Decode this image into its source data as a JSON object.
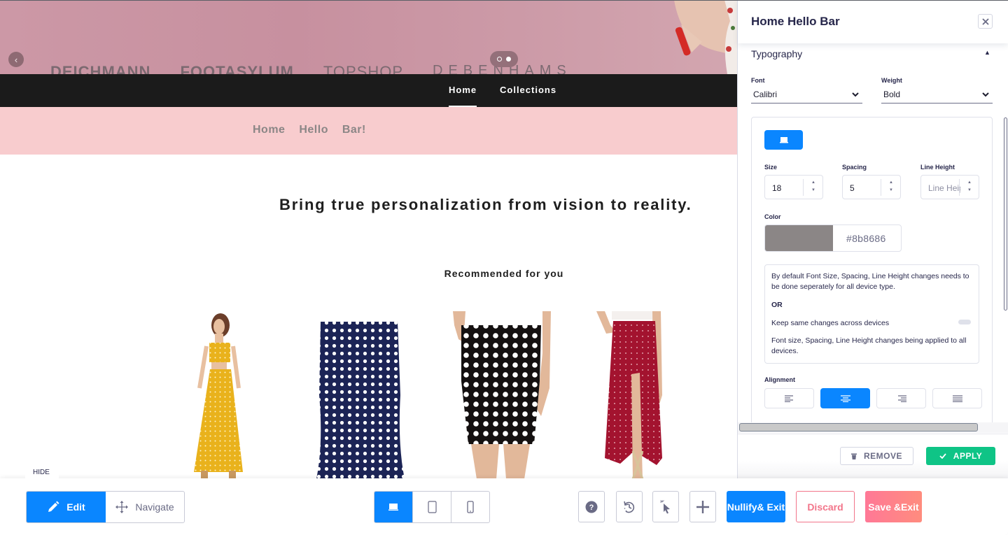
{
  "preview": {
    "hero": {
      "brand_logos": [
        "DEICHMANN",
        "FOOTASYLUM",
        "TOPSHOP",
        "DEBENHAMS"
      ],
      "slide_count": 2,
      "active_slide": 2
    },
    "nav": {
      "items": [
        {
          "label": "Home",
          "active": true
        },
        {
          "label": "Collections",
          "active": false
        }
      ]
    },
    "hello_bar": {
      "text": "Home  Hello  Bar!",
      "background": "#f8ccce",
      "text_color": "#8b8686"
    },
    "headline": "Bring true personalization from vision to reality.",
    "recommendations": {
      "title": "Recommended for you",
      "products": [
        {
          "name": "yellow-polka-dot-maxi-set",
          "color": "#e9b21c"
        },
        {
          "name": "navy-polka-dot-mermaid-skirt",
          "color": "#1c2456"
        },
        {
          "name": "black-polka-dot-pencil-skirt",
          "color": "#141010"
        },
        {
          "name": "red-polka-dot-wrap-maxi-skirt",
          "color": "#a3132f"
        }
      ]
    }
  },
  "panel": {
    "title": "Home Hello Bar",
    "section": "Typography",
    "font": {
      "label": "Font",
      "value": "Calibri"
    },
    "weight": {
      "label": "Weight",
      "value": "Bold"
    },
    "size": {
      "label": "Size",
      "value": "18"
    },
    "spacing": {
      "label": "Spacing",
      "value": "5"
    },
    "line_height": {
      "label": "Line Height",
      "placeholder": "Line Height",
      "value": ""
    },
    "color": {
      "label": "Color",
      "value": "#8b8686"
    },
    "info": {
      "line1": "By default Font Size, Spacing, Line Height changes needs to be done seperately for all device type.",
      "or": "OR",
      "toggle_label": "Keep same changes across devices",
      "toggle_on": false,
      "line2": "Font size, Spacing, Line Height changes being applied to all devices."
    },
    "alignment": {
      "label": "Alignment",
      "options": [
        "left",
        "center",
        "right",
        "justify"
      ],
      "selected": "center"
    },
    "remove_label": "REMOVE",
    "apply_label": "APPLY"
  },
  "toolbar": {
    "hide_label": "HIDE",
    "edit_label": "Edit",
    "navigate_label": "Navigate",
    "devices": [
      "desktop",
      "tablet",
      "mobile"
    ],
    "active_device": "desktop",
    "nullify_label": "Nullify & Exit",
    "discard_label": "Discard",
    "save_label": "Save & Exit"
  },
  "colors": {
    "primary": "#0a86ff",
    "success": "#0fc486",
    "danger": "#f2758a"
  }
}
